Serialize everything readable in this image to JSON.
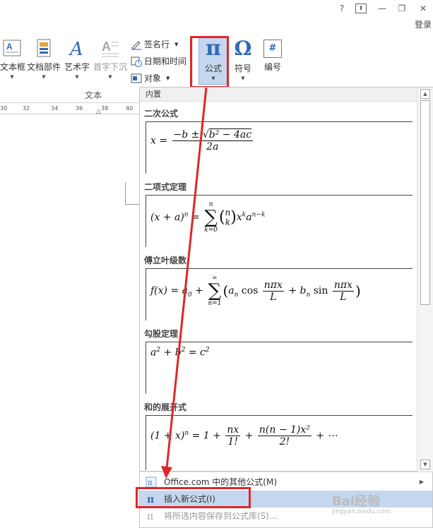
{
  "window": {
    "help": "?",
    "restore_ribbon": "⊡",
    "minimize": "—",
    "maximize": "❐",
    "close": "✕",
    "login": "登录"
  },
  "ribbon": {
    "buttons": [
      {
        "label": "文本框"
      },
      {
        "label": "文档部件"
      },
      {
        "label": "艺术字"
      },
      {
        "label": "首字下沉"
      }
    ],
    "small": [
      {
        "label": "签名行"
      },
      {
        "label": "日期和时间"
      },
      {
        "label": "对象"
      }
    ],
    "equation": {
      "label": "公式",
      "icon": "π"
    },
    "symbol": {
      "label": "符号",
      "icon": "Ω"
    },
    "number": {
      "label": "编号",
      "icon": "#"
    },
    "group_text": "文本"
  },
  "ruler": [
    "30",
    "32",
    "34",
    "36",
    "38",
    "40"
  ],
  "gallery": {
    "header": "内置",
    "categories": [
      {
        "title": "二次公式"
      },
      {
        "title": "二项式定理"
      },
      {
        "title": "傅立叶级数"
      },
      {
        "title": "勾股定理"
      },
      {
        "title": "和的展开式"
      }
    ]
  },
  "menu": {
    "items": [
      {
        "label": "Office.com 中的其他公式(M)"
      },
      {
        "label": "插入新公式(I)"
      },
      {
        "label": "将所选内容保存到公式库(S)..."
      }
    ]
  },
  "watermark": {
    "title": "Bai经验",
    "sub": "jingyan.baidu.com"
  },
  "colors": {
    "highlight": "#c5d7ee",
    "annotation": "#e0262a",
    "icon_blue": "#2e6bb5"
  }
}
